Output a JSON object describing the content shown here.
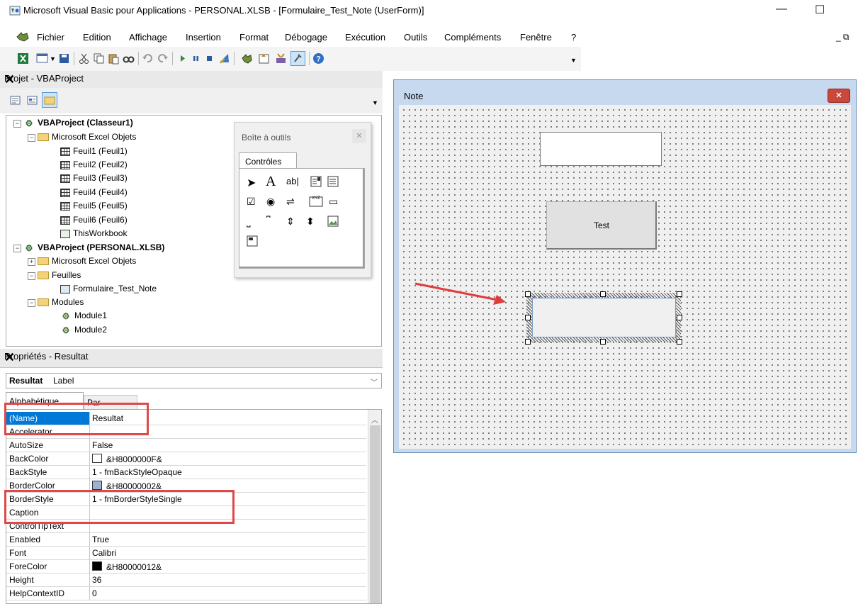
{
  "window": {
    "title": "Microsoft Visual Basic pour Applications - PERSONAL.XLSB - [Formulaire_Test_Note (UserForm)]",
    "minimize_glyph": "—",
    "maximize_glyph": "☐",
    "mdi_restore_glyph": "_ ⧉"
  },
  "menu": [
    "Fichier",
    "Edition",
    "Affichage",
    "Insertion",
    "Format",
    "Débogage",
    "Exécution",
    "Outils",
    "Compléments",
    "Fenêtre",
    "?"
  ],
  "project_panel": {
    "title": "Projet - VBAProject",
    "tree": [
      {
        "label": "VBAProject (Classeur1)"
      },
      {
        "label": "Microsoft Excel Objets"
      },
      {
        "label": "Feuil1 (Feuil1)"
      },
      {
        "label": "Feuil2 (Feuil2)"
      },
      {
        "label": "Feuil3 (Feuil3)"
      },
      {
        "label": "Feuil4 (Feuil4)"
      },
      {
        "label": "Feuil5 (Feuil5)"
      },
      {
        "label": "Feuil6 (Feuil6)"
      },
      {
        "label": "ThisWorkbook"
      },
      {
        "label": "VBAProject (PERSONAL.XLSB)"
      },
      {
        "label": "Microsoft Excel Objets"
      },
      {
        "label": "Feuilles"
      },
      {
        "label": "Formulaire_Test_Note"
      },
      {
        "label": "Modules"
      },
      {
        "label": "Module1"
      },
      {
        "label": "Module2"
      }
    ]
  },
  "toolbox": {
    "title": "Boîte à outils",
    "tab": "Contrôles"
  },
  "properties_panel": {
    "title": "Propriétés - Resultat",
    "object_name": "Resultat",
    "object_type": "Label",
    "tabs": [
      "Alphabétique",
      "Par catégorie"
    ],
    "rows": [
      {
        "name": "(Name)",
        "value": ""
      },
      {
        "name": "Accelerator",
        "value": ""
      },
      {
        "name": "AutoSize",
        "value": "False"
      },
      {
        "name": "BackColor",
        "value": "&H8000000F&",
        "swatch": "#ffffff"
      },
      {
        "name": "BackStyle",
        "value": "1 - fmBackStyleOpaque"
      },
      {
        "name": "BorderColor",
        "value": "&H80000002&",
        "swatch": "#99b4d1"
      },
      {
        "name": "BorderStyle",
        "value": "1 - fmBorderStyleSingle"
      },
      {
        "name": "Caption",
        "value": ""
      },
      {
        "name": "ControlTipText",
        "value": ""
      },
      {
        "name": "Enabled",
        "value": "True"
      },
      {
        "name": "Font",
        "value": "Calibri"
      },
      {
        "name": "ForeColor",
        "value": "&H80000012&",
        "swatch": "#000000"
      },
      {
        "name": "Height",
        "value": "36"
      },
      {
        "name": "HelpContextID",
        "value": "0"
      }
    ],
    "name_value": "Resultat"
  },
  "userform": {
    "caption": "Note",
    "button_caption": "Test",
    "close_glyph": "✕"
  },
  "colors": {
    "highlight": "#e04848",
    "arrow": "#e03c3c",
    "selection": "#0078d7"
  }
}
